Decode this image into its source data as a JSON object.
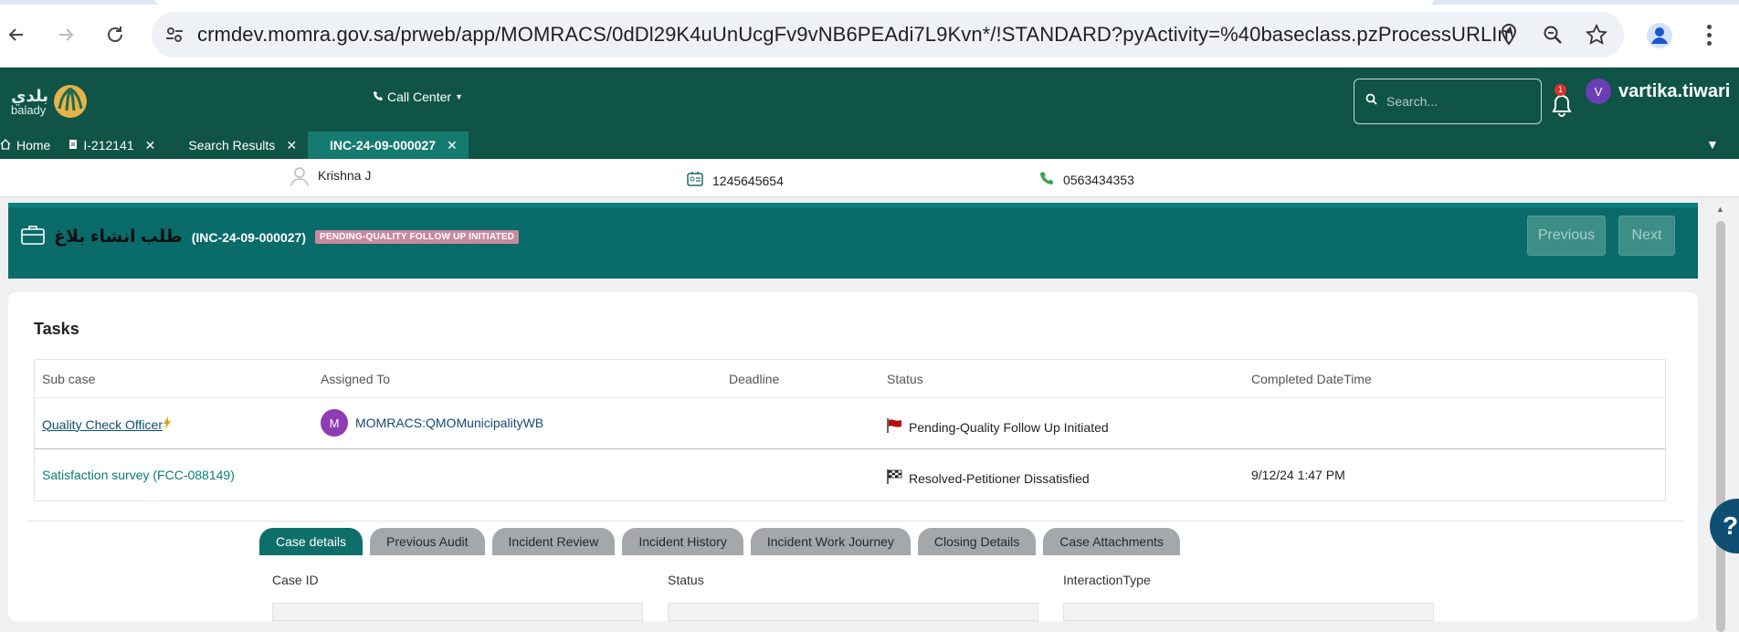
{
  "browser": {
    "url": "crmdev.momra.gov.sa/prweb/app/MOMRACS/0dDl29K4uUnUcgFv9vNB6PEAdi7L9Kvn*/!STANDARD?pyActivity=%40baseclass.pzProcessURLInWindo..."
  },
  "header": {
    "logo_text_ar": "بلدي",
    "logo_text_en": "balady",
    "call_center_label": "Call Center",
    "search_placeholder": "Search...",
    "notification_count": "1",
    "user_initial": "V",
    "user_name": "vartika.tiwari"
  },
  "work_tabs": [
    {
      "label": "Home",
      "icon": "home-icon",
      "closable": false,
      "active": false
    },
    {
      "label": "I-212141",
      "icon": "document-icon",
      "closable": true,
      "active": false
    },
    {
      "label": "Search Results",
      "icon": "",
      "closable": true,
      "active": false
    },
    {
      "label": "INC-24-09-000027",
      "icon": "",
      "closable": true,
      "active": true
    }
  ],
  "contact": {
    "name": "Krishna J",
    "id_number": "1245645654",
    "phone": "0563434353"
  },
  "case": {
    "title_ar": "طلب انشاء بلاغ",
    "case_id": "(INC-24-09-000027)",
    "status": "PENDING-QUALITY FOLLOW UP INITIATED",
    "previous_label": "Previous",
    "next_label": "Next"
  },
  "tasks": {
    "title": "Tasks",
    "columns": [
      "Sub case",
      "Assigned To",
      "Deadline",
      "Status",
      "Completed DateTime"
    ],
    "rows": [
      {
        "subcase": "Quality Check Officer",
        "assignee_initial": "M",
        "assignee": "MOMRACS:QMOMunicipalityWB",
        "deadline": "",
        "status": "Pending-Quality Follow Up Initiated",
        "completed": ""
      },
      {
        "subcase": "Satisfaction survey (FCC-088149)",
        "assignee_initial": "",
        "assignee": "",
        "deadline": "",
        "status": "Resolved-Petitioner Dissatisfied",
        "completed": "9/12/24 1:47 PM"
      }
    ]
  },
  "detail_tabs": [
    "Case details",
    "Previous Audit",
    "Incident Review",
    "Incident History",
    "Incident Work Journey",
    "Closing Details",
    "Case Attachments"
  ],
  "fields": {
    "case_id_label": "Case ID",
    "status_label": "Status",
    "interaction_type_label": "InteractionType"
  },
  "help_label": "?",
  "colors": {
    "header_bg": "#0f5447",
    "banner_bg": "#0a6b6b",
    "active_tab": "#0e6f6a",
    "status_pill": "#c88a9d"
  }
}
